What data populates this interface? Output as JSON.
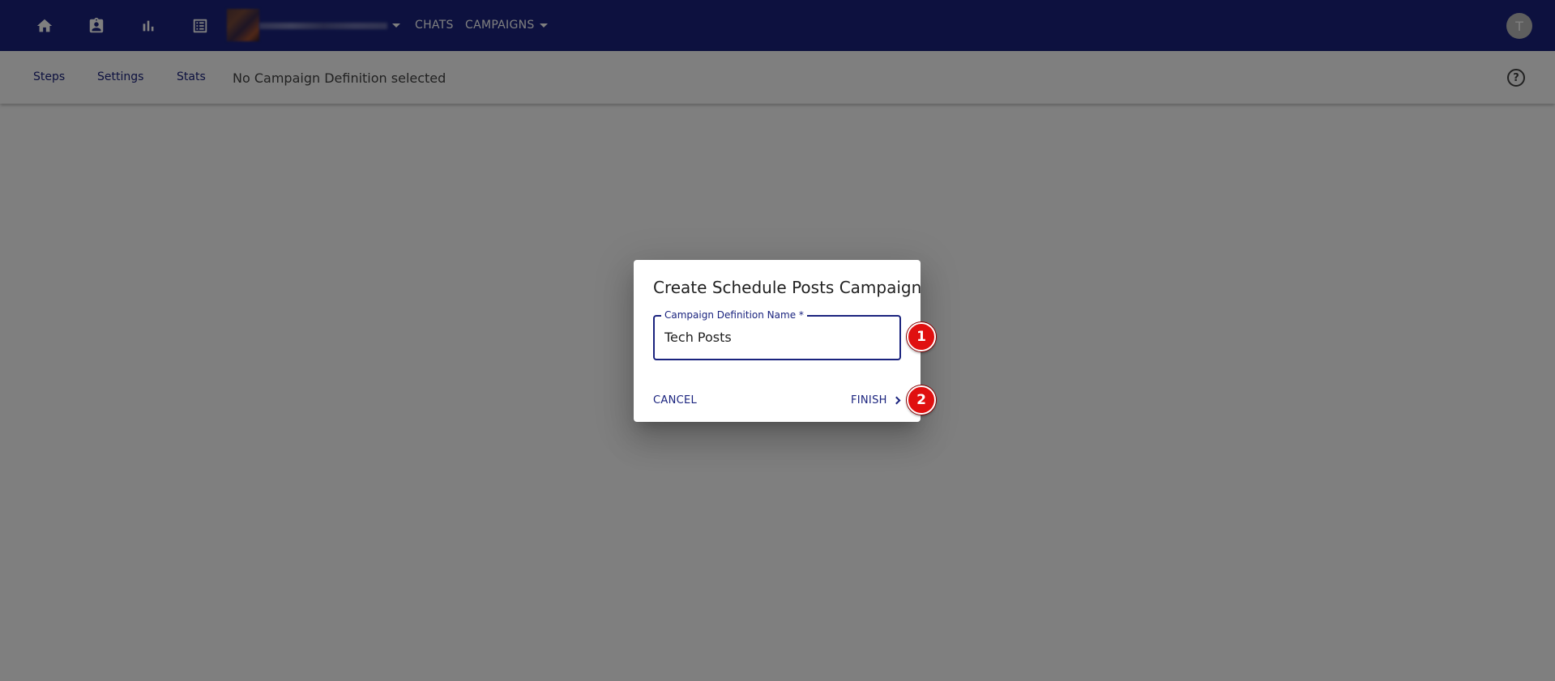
{
  "topbar": {
    "icons": [
      "home-icon",
      "contact-icon",
      "bar-chart-icon",
      "list-icon"
    ],
    "nav": {
      "chats_label": "CHATS",
      "campaigns_label": "CAMPAIGNS"
    },
    "user_avatar_initial": "T",
    "colors": {
      "background": "#1a237e"
    }
  },
  "subbar": {
    "tabs": [
      "Steps",
      "Settings",
      "Stats"
    ],
    "status_text": "No Campaign Definition selected",
    "help_icon": "?"
  },
  "dialog": {
    "title": "Create Schedule Posts Campaign",
    "field": {
      "label": "Campaign Definition Name *",
      "value": "Tech Posts"
    },
    "cancel_label": "CANCEL",
    "finish_label": "FINISH"
  },
  "markers": [
    "1",
    "2"
  ]
}
